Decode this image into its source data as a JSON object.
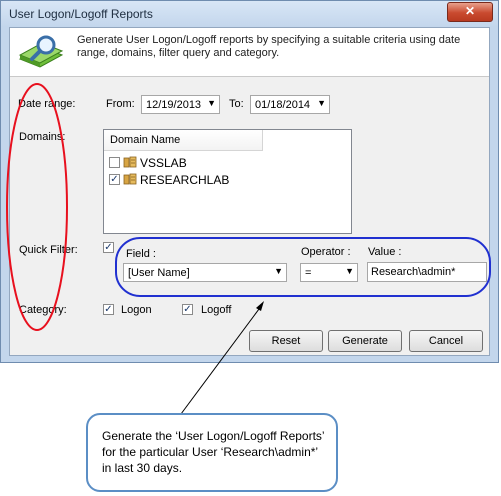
{
  "window": {
    "title": "User Logon/Logoff Reports",
    "close_glyph": "✕"
  },
  "banner": {
    "text": "Generate User Logon/Logoff reports by specifying a suitable criteria using date range, domains, filter query and category.",
    "icon": "book-magnifier-icon"
  },
  "date_range": {
    "label": "Date range:",
    "from_label": "From:",
    "from_value": "12/19/2013",
    "to_label": "To:",
    "to_value": "01/18/2014"
  },
  "domains": {
    "label": "Domains:",
    "column_header": "Domain Name",
    "items": [
      {
        "name": "VSSLAB",
        "checked": false
      },
      {
        "name": "RESEARCHLAB",
        "checked": true
      }
    ]
  },
  "quick_filter": {
    "label": "Quick Filter:",
    "enabled": true,
    "field_label": "Field :",
    "field_value": "[User Name]",
    "operator_label": "Operator :",
    "operator_value": "=",
    "value_label": "Value :",
    "value_value": "Research\\admin*"
  },
  "category": {
    "label": "Category:",
    "logon_label": "Logon",
    "logoff_label": "Logoff",
    "logon_checked": true,
    "logoff_checked": true
  },
  "buttons": {
    "reset": "Reset",
    "generate": "Generate",
    "cancel": "Cancel"
  },
  "annotation": {
    "text": "Generate the ‘User Logon/Logoff Reports’ for the particular User ‘Research\\admin*’ in last 30 days."
  },
  "colors": {
    "red_mark": "#e8101e",
    "blue_mark": "#2030d0",
    "callout_border": "#5b8ec5"
  }
}
